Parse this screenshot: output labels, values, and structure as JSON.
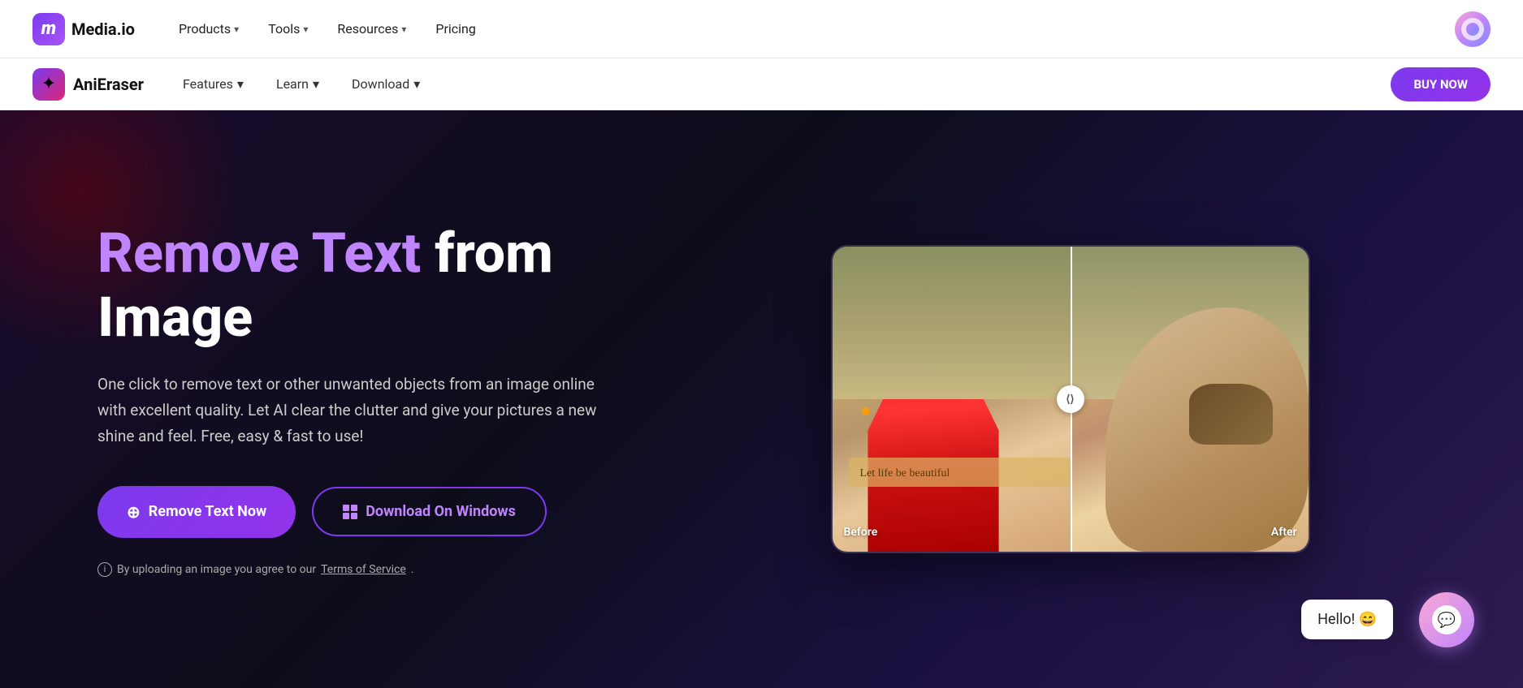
{
  "top_nav": {
    "logo_icon": "m",
    "logo_name": "Media.io",
    "links": [
      {
        "label": "Products",
        "has_chevron": true
      },
      {
        "label": "Tools",
        "has_chevron": true
      },
      {
        "label": "Resources",
        "has_chevron": true
      },
      {
        "label": "Pricing",
        "has_chevron": false
      }
    ]
  },
  "sec_nav": {
    "brand": "AniEraser",
    "brand_icon": "✦",
    "links": [
      {
        "label": "Features",
        "has_chevron": true
      },
      {
        "label": "Learn",
        "has_chevron": true
      },
      {
        "label": "Download",
        "has_chevron": true
      }
    ],
    "buy_btn": "BUY NOW"
  },
  "hero": {
    "title_purple": "Remove Text",
    "title_white_1": " from",
    "title_white_2": "Image",
    "description": "One click to remove text or other unwanted objects from an image online with excellent quality. Let AI clear the clutter and give your pictures a new shine and feel. Free, easy & fast to use!",
    "btn_remove": "Remove Text Now",
    "btn_windows": "Download On Windows",
    "terms_text": "By uploading an image you agree to our",
    "terms_link": "Terms of Service",
    "terms_period": ".",
    "comparison": {
      "text_overlay": "Let life be beautiful",
      "label_before": "Before",
      "label_after": "After",
      "divider_handle": "⟨⟩"
    }
  },
  "chat": {
    "hello_text": "Hello! 😄",
    "chat_emoji": "💬"
  },
  "colors": {
    "purple": "#c084fc",
    "accent": "#7c3aed",
    "bg_dark": "#0d0d1a"
  }
}
